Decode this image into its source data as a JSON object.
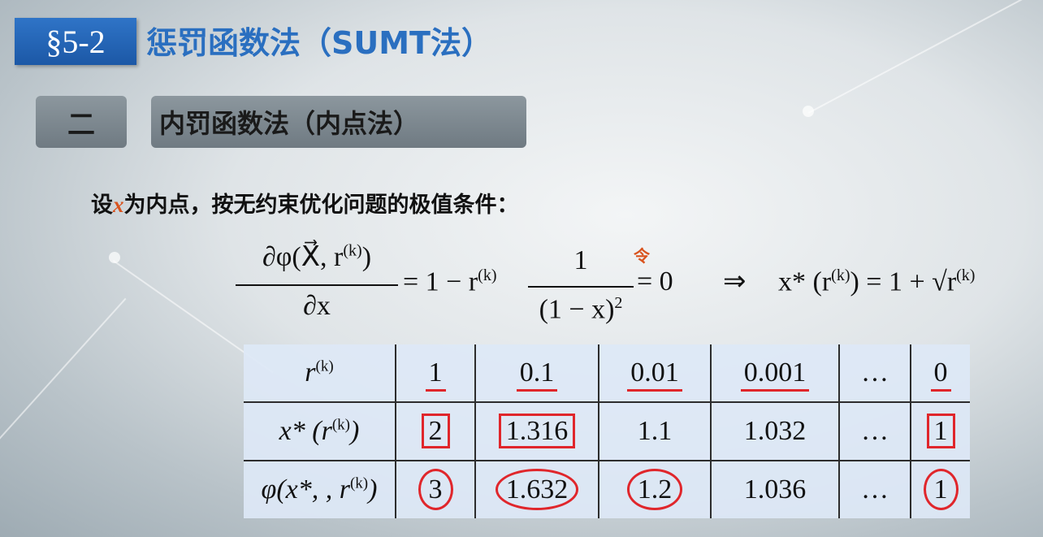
{
  "header": {
    "section_badge": "§5-2",
    "section_title": "惩罚函数法（SUMT法）"
  },
  "subheader": {
    "number": "二",
    "title": "内罚函数法（内点法）"
  },
  "intro": {
    "prefix": "设",
    "variable": "x",
    "suffix": "为内点，按无约束优化问题的极值条件："
  },
  "formula": {
    "lhs_numerator": "∂φ(X⃗, r",
    "lhs_sup": "(k)",
    "lhs_close": ")",
    "lhs_denominator": "∂x",
    "middle": "= 1 − r",
    "middle_sup": "(k)",
    "frac_numerator": "1",
    "frac_denominator": "(1 − x)",
    "frac_sup": "2",
    "equals_zero": "= 0",
    "annotation": "令",
    "implies": "⇒",
    "result": "x* (r",
    "result_sup": "(k)",
    "result_tail": ") = 1 + √r",
    "result_tail_sup": "(k)"
  },
  "table": {
    "row_headers": [
      {
        "main": "r",
        "sup": "(k)",
        "tail": ""
      },
      {
        "main": "x* (r",
        "sup": "(k)",
        "tail": ")"
      },
      {
        "main": "φ(x*, , r",
        "sup": "(k)",
        "tail": ")"
      }
    ],
    "r_values": [
      "1",
      "0.1",
      "0.01",
      "0.001",
      "…",
      "0"
    ],
    "x_values": [
      "2",
      "1.316",
      "1.1",
      "1.032",
      "…",
      "1"
    ],
    "phi_values": [
      "3",
      "1.632",
      "1.2",
      "1.036",
      "…",
      "1"
    ]
  },
  "colors": {
    "badge_blue": "#1c58a6",
    "title_blue": "#2a6fc0",
    "highlight_red": "#e0262b",
    "accent_orange": "#d9531e"
  }
}
